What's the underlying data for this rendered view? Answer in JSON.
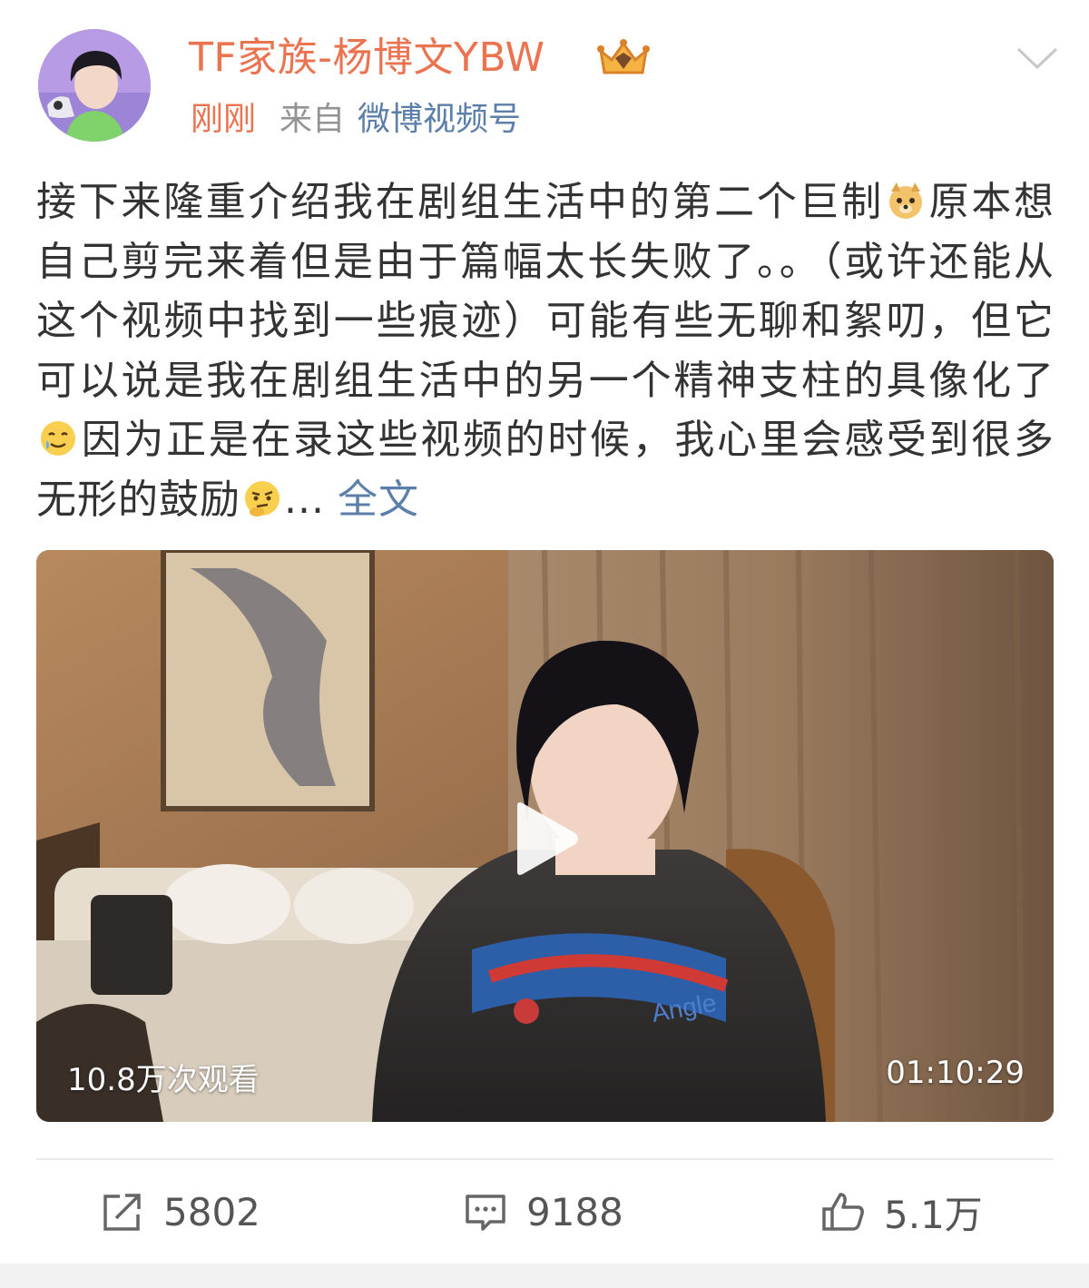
{
  "post": {
    "username": "TF家族-杨博文YBW",
    "time": "刚刚",
    "from_label": "来自",
    "source": "微博视频号",
    "text_parts": [
      "接下来隆重介绍我在剧组生活中的第二个巨制",
      "原本想自己剪完来着但是由于篇幅太长失败了。。（或许还能从这个视频中找到一些痕迹）可能有些无聊和絮叨，但它可以说是我在剧组生活中的另一个精神支柱的具像化了",
      "因为正是在录这些视频的时候，我心里会感受到很多无形的鼓励",
      "..."
    ],
    "more_label": "全文",
    "emojis": [
      "doge-emoji",
      "tear-smile-emoji",
      "thinking-emoji"
    ]
  },
  "video": {
    "views": "10.8万次观看",
    "duration": "01:10:29"
  },
  "actions": {
    "repost_count": "5802",
    "comment_count": "9188",
    "like_count": "5.1万"
  },
  "colors": {
    "username": "#eb7350",
    "link": "#5b7fa8",
    "meta_gray": "#939393",
    "text": "#333333"
  },
  "icons": [
    "crown-badge-icon",
    "chevron-down-icon",
    "play-icon",
    "repost-icon",
    "comment-icon",
    "like-icon"
  ]
}
